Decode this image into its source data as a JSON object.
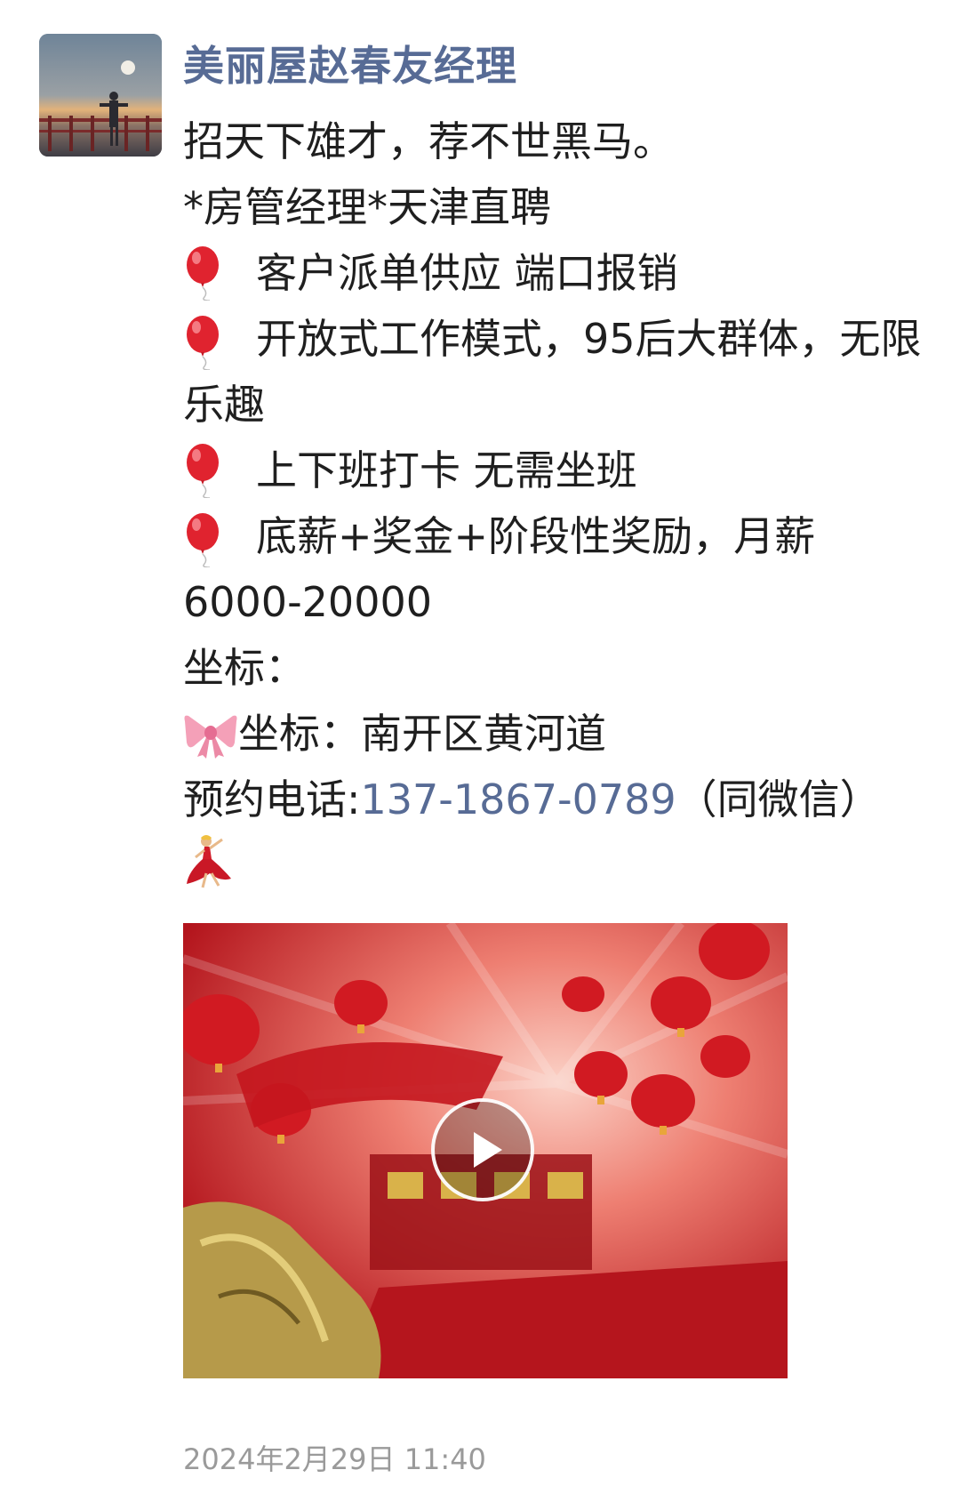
{
  "post": {
    "author": "美丽屋赵春友经理",
    "lines": {
      "l1": "招天下雄才，荐不世黑马。",
      "l2": "*房管经理*天津直聘",
      "b1": "客户派单供应 端口报销",
      "b2": "开放式工作模式，95后大群体，无限乐趣",
      "b3": "上下班打卡 无需坐班",
      "b4": "底薪+奖金+阶段性奖励，月薪6000-20000",
      "coord_label": "坐标：",
      "coord_value": "坐标：南开区黄河道",
      "phone_prefix": "预约电话:",
      "phone": "137-1867-0789",
      "phone_suffix": "（同微信）"
    },
    "emojis": {
      "bullet": "balloon-icon",
      "coordinate": "ribbon-bow-icon",
      "ending": "dancer-icon"
    },
    "timestamp": "2024年2月29日 11:40"
  },
  "colors": {
    "author_name": "#576b95",
    "link": "#576b95",
    "timestamp": "#9a9a9a",
    "body_text": "#1f1f1f"
  }
}
